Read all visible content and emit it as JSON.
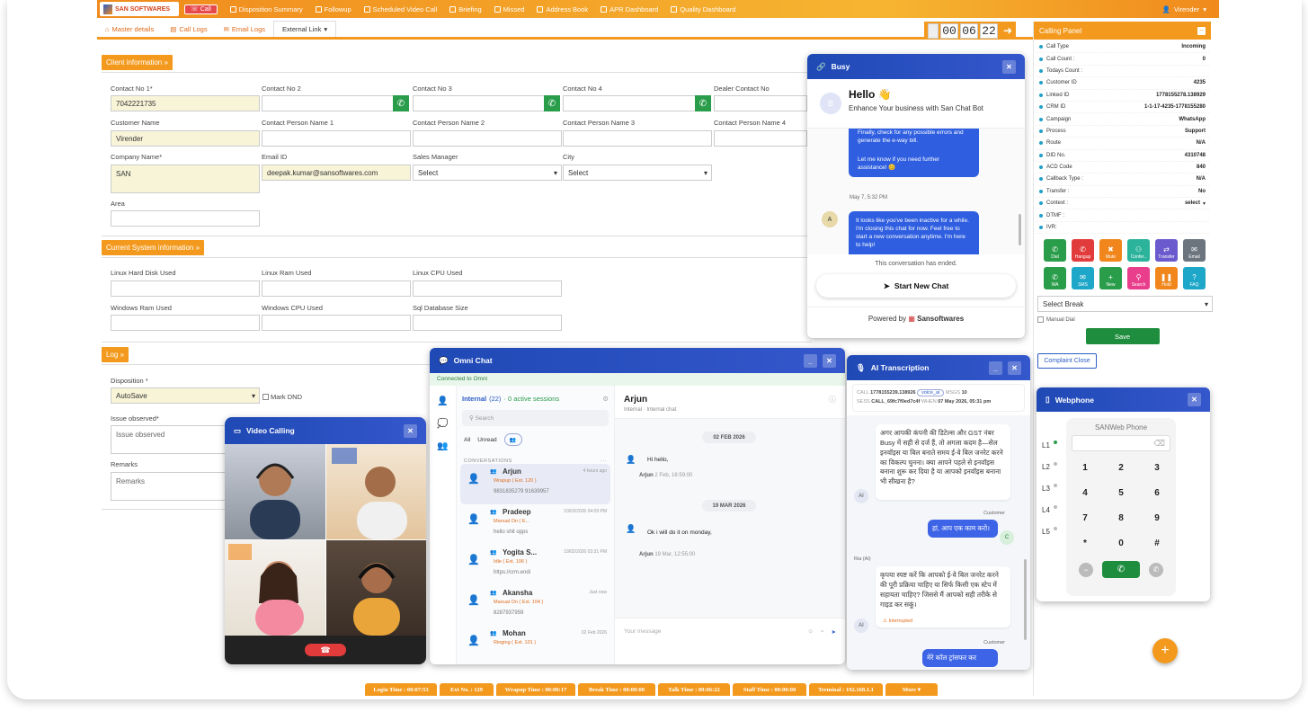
{
  "topnav": {
    "brand": "SAN SOFTWARES",
    "brand_sub": "A COMPLETE SOLUTION",
    "call": "Call",
    "items": [
      "Disposition Summary",
      "Followup",
      "Scheduled Video Call",
      "Briefing",
      "Missed",
      "Address Book",
      "APR Dashboard",
      "Quality Dashboard"
    ],
    "user": "Virender"
  },
  "tabs": [
    "Master details",
    "Call Logs",
    "Email Logs",
    "External Link"
  ],
  "timer": {
    "h": "00",
    "m": "06",
    "s": "22"
  },
  "client": {
    "title": "Client information",
    "fields": [
      {
        "label": "Contact No 1*",
        "value": "7042221735"
      },
      {
        "label": "Contact No 2",
        "value": ""
      },
      {
        "label": "Contact No 3",
        "value": ""
      },
      {
        "label": "Contact No 4",
        "value": ""
      },
      {
        "label": "Dealer Contact No",
        "value": ""
      },
      {
        "label": "Customer Name",
        "value": "Virender"
      },
      {
        "label": "Contact Person Name 1",
        "value": ""
      },
      {
        "label": "Contact Person Name 2",
        "value": ""
      },
      {
        "label": "Contact Person Name 3",
        "value": ""
      },
      {
        "label": "Contact Person Name 4",
        "value": ""
      },
      {
        "label": "Company Name*",
        "value": "SAN"
      },
      {
        "label": "Email ID",
        "value": "deepak.kumar@sansoftwares.com"
      },
      {
        "label": "Sales Manager",
        "value": "Select"
      },
      {
        "label": "City",
        "value": "Select"
      },
      {
        "label": "Area",
        "value": ""
      }
    ]
  },
  "system": {
    "title": "Current System information",
    "fields": [
      "Linux Hard Disk Used",
      "Linux Ram Used",
      "Linux CPU Used",
      "Windows Ram Used",
      "Windows CPU Used",
      "Sql Database Size"
    ]
  },
  "log": {
    "title": "Log",
    "disposition_label": "Disposition *",
    "disposition_value": "AutoSave",
    "mark_dnd": "Mark DND",
    "issue_label": "Issue observed*",
    "issue_placeholder": "Issue observed",
    "remarks_label": "Remarks",
    "remarks_placeholder": "Remarks"
  },
  "calling_panel": {
    "title": "Calling Panel",
    "rows": [
      {
        "k": "Call Type",
        "v": "Incoming"
      },
      {
        "k": "Call Count :",
        "v": "0"
      },
      {
        "k": "Todays Count :",
        "v": ""
      },
      {
        "k": "Customer ID",
        "v": "4235"
      },
      {
        "k": "Linked ID",
        "v": "1778155278.138929"
      },
      {
        "k": "CRM ID",
        "v": "1-1-17-4235-1778155280"
      },
      {
        "k": "Campaign",
        "v": "WhatsApp"
      },
      {
        "k": "Process",
        "v": "Support"
      },
      {
        "k": "Route",
        "v": "N/A"
      },
      {
        "k": "DID No.",
        "v": "4310748"
      },
      {
        "k": "ACD Code",
        "v": "840"
      },
      {
        "k": "Callback Type :",
        "v": "N/A"
      },
      {
        "k": "Transfer :",
        "v": "No"
      },
      {
        "k": "Context :",
        "v": "select"
      },
      {
        "k": "DTMF :",
        "v": ""
      },
      {
        "k": "IVR:",
        "v": ""
      }
    ],
    "buttons": [
      {
        "l": "Dial",
        "c": "#2a9d4b"
      },
      {
        "l": "Hangup",
        "c": "#e23b3b"
      },
      {
        "l": "Mute",
        "c": "#f0861c"
      },
      {
        "l": "Confer..",
        "c": "#2bb39b"
      },
      {
        "l": "Transfer",
        "c": "#6a5acd"
      },
      {
        "l": "Email",
        "c": "#6c757d"
      },
      {
        "l": "WA",
        "c": "#2a9d4b"
      },
      {
        "l": "SMS",
        "c": "#1ea7c8"
      },
      {
        "l": "New",
        "c": "#2a9d4b"
      },
      {
        "l": "Search",
        "c": "#e83e8c"
      },
      {
        "l": "Hold",
        "c": "#f0861c"
      },
      {
        "l": "FAQ",
        "c": "#1ea7c8"
      }
    ],
    "select_break": "Select Break",
    "manual_dial": "Manual Dial",
    "save": "Save",
    "complaint_close": "Complaint Close"
  },
  "chatbot": {
    "title": "Busy",
    "hello": "Hello 👋",
    "tagline": "Enhance Your business with San Chat Bot",
    "msg1_a": "Finally, check for any possible errors and generate the e-way bill.",
    "msg1_b": "Let me know if you need further assistance! 😊",
    "msg1_time": "May 7, 5:32 PM",
    "msg2": "It looks like you've been inactive for a while. I'm closing this chat for now. Feel free to start a new conversation anytime. I'm here to help!",
    "ended": "This conversation has ended.",
    "start": "Start New Chat",
    "powered": "Powered by",
    "brand": "Sansoftwares"
  },
  "omni": {
    "title": "Omni Chat",
    "connected": "Connected to Omni",
    "internal": "Internal",
    "count": "(22)",
    "active": "· 0 active sessions",
    "search": "Search",
    "filters": [
      "All",
      "Unread"
    ],
    "conv_label": "CONVERSATIONS",
    "convs": [
      {
        "name": "Arjun",
        "time": "4 hours ago",
        "status": "Wrapup ( Ext. 120 )",
        "preview": "9831835279 91639957"
      },
      {
        "name": "Pradeep",
        "time": "10/03/2026 04:09 PM",
        "status": "Manual On ( E...",
        "preview": "hello shit opps"
      },
      {
        "name": "Yogita S...",
        "time": "19/02/2026 03:31 PM",
        "status": "Idle ( Ext. 106 )",
        "preview": "https://crm.endi"
      },
      {
        "name": "Akansha",
        "time": "Just now",
        "status": "Manual On ( Ext. 104 )",
        "preview": "8287937959"
      },
      {
        "name": "Mohan",
        "time": "02 Feb 2026",
        "status": "Ringing ( Ext. 101 )",
        "preview": ""
      }
    ],
    "chat_name": "Arjun",
    "chat_sub": "Internal · Internal chat",
    "date1": "02 FEB 2026",
    "m1": "Hi hello,",
    "m1_meta": "Arjun",
    "m1_time": "2 Feb, 16:59:00",
    "date2": "19 MAR 2026",
    "m2": "Ok i will do it on monday,",
    "m2_meta": "Arjun",
    "m2_time": "19 Mar, 12:55:00",
    "input": "Your message"
  },
  "video": {
    "title": "Video Calling"
  },
  "ai": {
    "title": "AI Transcription",
    "call": "1778155239.138926",
    "tag": "voice_ai",
    "msgs": "10",
    "sess": "CALL_69fc7f0ed7c4f",
    "when": "07 May 2026, 05:31 pm",
    "b1": "अगर आपकी कंपनी की डिटेल्स और GST नंबर Busy में सही से दर्ज हैं, तो अगला कदम है—सेल इनवॉइस या बिल बनाते समय ई-वे बिल जनरेट करने का विकल्प चुनना। क्या आपने पहले से इनवॉइस बनाना शुरू कर दिया है या आपको इनवॉइस बनाना भी सीखना है?",
    "customer": "Customer",
    "b2": "हां, आप एक काम करो।",
    "ria": "Ria (AI)",
    "b3": "कृपया स्पष्ट करें कि आपको ई-वे बिल जनरेट करने की पूरी प्रक्रिया चाहिए या सिर्फ किसी एक स्टेप में सहायता चाहिए? जिससे मैं आपको सही तरीके से गाइड कर सकूं।",
    "interrupted": "Interrupted",
    "b4": "मेरे कॉल ट्रांसफर कर"
  },
  "webphone": {
    "title": "Webphone",
    "brand": "SANWeb Phone",
    "lines": [
      "L1",
      "L2",
      "L3",
      "L4",
      "L5"
    ],
    "keys": [
      "1",
      "2",
      "3",
      "4",
      "5",
      "6",
      "7",
      "8",
      "9",
      "*",
      "0",
      "#"
    ]
  },
  "statusbar": [
    {
      "t": "Login Time : 00:07:53",
      "w": 80
    },
    {
      "t": "Ext No. : 129",
      "w": 60
    },
    {
      "t": "Wrapup Time : 00:00:17",
      "w": 88
    },
    {
      "t": "Break Time : 00:00:00",
      "w": 86
    },
    {
      "t": "Talk Time : 00:06:22",
      "w": 80
    },
    {
      "t": "Staff Time : 00:00:00",
      "w": 82
    },
    {
      "t": "Terminal : 192.168.1.1",
      "w": 82
    },
    {
      "t": "More ▾",
      "w": 58
    }
  ]
}
